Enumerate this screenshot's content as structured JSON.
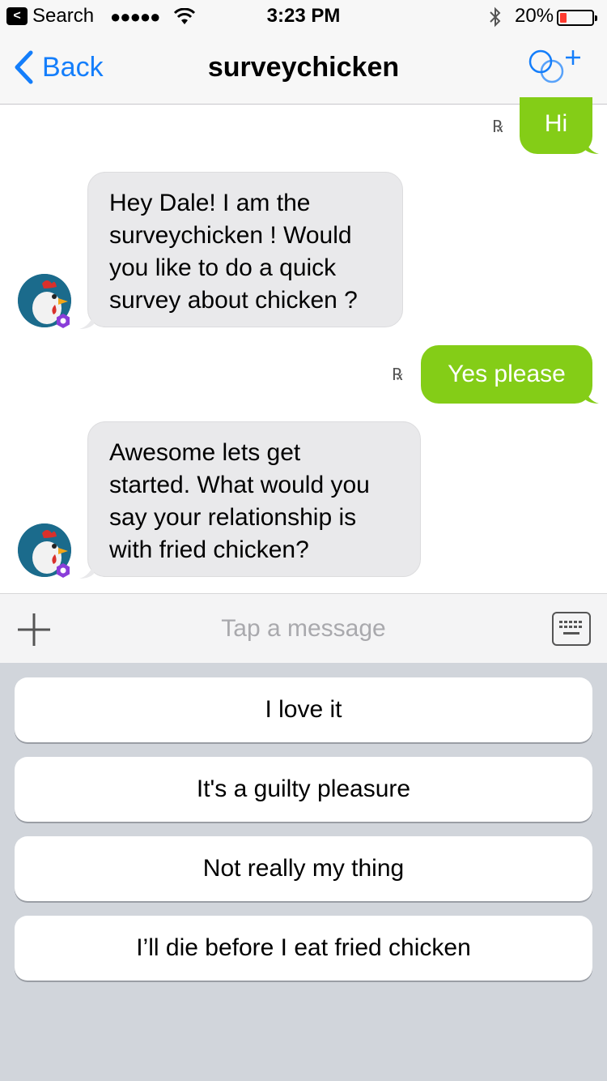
{
  "status_bar": {
    "back_app": "Search",
    "signal": "●●●●●",
    "time": "3:23 PM",
    "battery_percent": "20%",
    "battery_level": 0.2
  },
  "nav": {
    "back_label": "Back",
    "title": "surveychicken"
  },
  "messages": [
    {
      "direction": "outgoing",
      "text": "Hi",
      "read_mark": "R"
    },
    {
      "direction": "incoming",
      "lines": [
        "Hey Dale! I am the",
        "surveychicken ! Would",
        "you like to do a quick",
        "survey about chicken ?"
      ]
    },
    {
      "direction": "outgoing",
      "text": "Yes please",
      "read_mark": "R"
    },
    {
      "direction": "incoming",
      "lines": [
        "Awesome lets get",
        "started. What would you",
        "say your relationship is",
        "with fried chicken?"
      ]
    }
  ],
  "input": {
    "placeholder": "Tap a message"
  },
  "quick_replies": [
    "I love it",
    "It's a guilty pleasure",
    "Not really my thing",
    "I’ll die before I eat fried chicken"
  ],
  "colors": {
    "accent": "#147efb",
    "outgoing_bubble": "#84cd17",
    "incoming_bubble": "#e9e9eb",
    "reply_area": "#d1d5db"
  }
}
